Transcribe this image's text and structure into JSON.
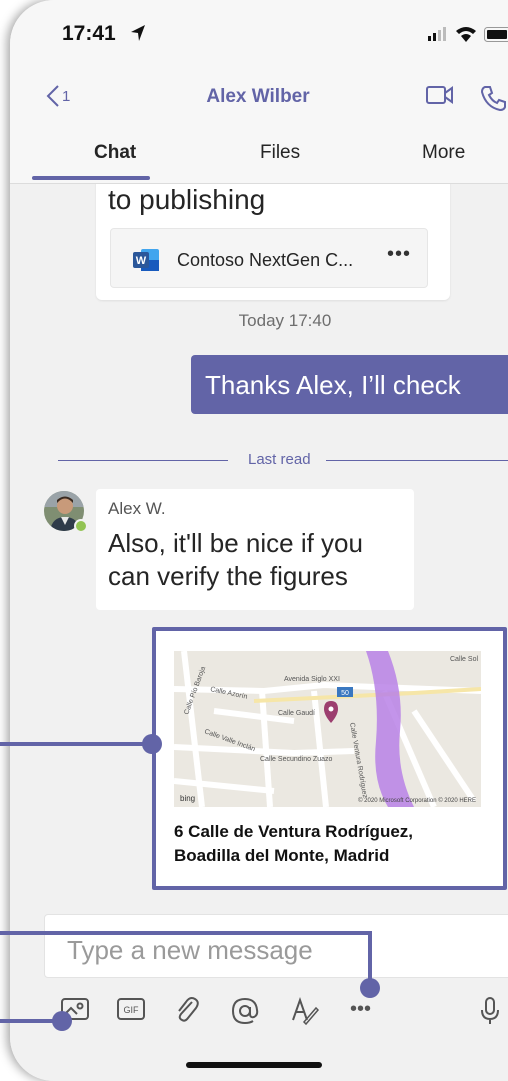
{
  "status_bar": {
    "time": "17:41"
  },
  "header": {
    "back_count": "1",
    "contact_name": "Alex Wilber"
  },
  "tabs": [
    {
      "label": "Chat",
      "active": true
    },
    {
      "label": "Files",
      "active": false
    },
    {
      "label": "More",
      "active": false
    }
  ],
  "messages": {
    "previous_text": "to publishing",
    "attachment_name": "Contoso NextGen C...",
    "date_separator": "Today 17:40",
    "my_message": "Thanks Alex, I’ll check",
    "last_read_label": "Last read",
    "incoming": {
      "sender": "Alex W.",
      "text": "Also, it'll be nice if you can verify the figures"
    },
    "location_card": {
      "address_line1": "6 Calle de Ventura Rodríguez,",
      "address_line2": "Boadilla del Monte,  Madrid",
      "map_labels": {
        "street_1": "Avenida Siglo XXI",
        "street_2": "Calle Azorín",
        "street_3": "Calle Gaudí",
        "street_4": "Calle Valle Inclán",
        "street_5": "Calle Secundino Zuazo",
        "street_6": "Calle Ventura Rodríguez",
        "street_7": "Calle Pío Baroja",
        "street_8": "Calle Sol",
        "road_badge": "50",
        "copyright": "© 2020 Microsoft Corporation © 2020 HERE",
        "bing": "bing"
      }
    }
  },
  "compose": {
    "placeholder": "Type a new message",
    "gif_label": "GIF",
    "more_label": "•••"
  },
  "colors": {
    "accent": "#6264a7",
    "presence": "#92c353",
    "word_blue": "#2b579a",
    "route": "#b981e6"
  }
}
